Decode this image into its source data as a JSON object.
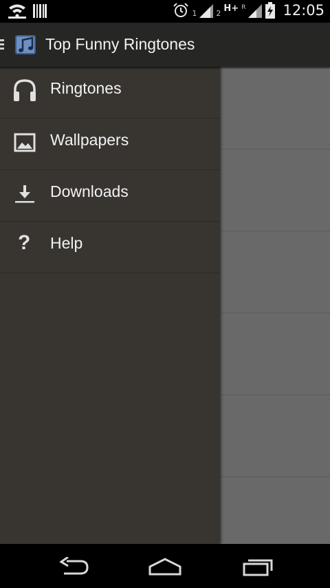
{
  "status_bar": {
    "sim1_label": "1",
    "sim2_label": "2",
    "network_type": "H+",
    "roaming_label": "R",
    "time": "12:05"
  },
  "action_bar": {
    "title": "Top Funny Ringtones",
    "app_icon": "music-note-app-icon",
    "drawer_indicator": "drawer-indicator-icon"
  },
  "drawer": {
    "items": [
      {
        "label": "Ringtones",
        "icon": "headphones-icon"
      },
      {
        "label": "Wallpapers",
        "icon": "image-icon"
      },
      {
        "label": "Downloads",
        "icon": "download-icon"
      },
      {
        "label": "Help",
        "icon": "help-icon"
      }
    ]
  },
  "nav_bar": {
    "back": "back-icon",
    "home": "home-icon",
    "recents": "recents-icon"
  },
  "colors": {
    "drawer_bg": "#383531",
    "action_bar_bg": "#262624",
    "content_bg": "#696969",
    "text": "#f2f2f2"
  }
}
